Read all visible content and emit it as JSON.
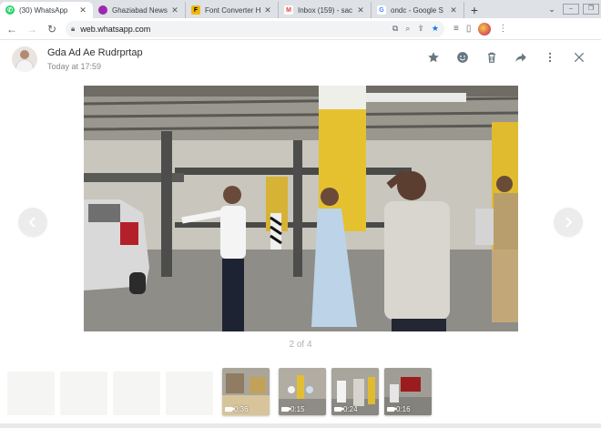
{
  "tabs": [
    {
      "title": "(30) WhatsApp",
      "icon": "whatsapp-icon",
      "color": "#25d366"
    },
    {
      "title": "Ghaziabad News",
      "icon": "news-icon",
      "color": "#9c27b0"
    },
    {
      "title": "Font Converter H",
      "icon": "font-converter-icon",
      "color": "#f2b705"
    },
    {
      "title": "Inbox (159) - sac",
      "icon": "gmail-icon",
      "color": "#ea4335"
    },
    {
      "title": "ondc - Google S",
      "icon": "google-icon",
      "color": "#4285f4"
    }
  ],
  "address": {
    "url": "web.whatsapp.com"
  },
  "viewer": {
    "sender": "Gda Ad Ae Rudrprtap",
    "timestamp": "Today at 17:59",
    "counter": "2 of 4"
  },
  "thumbnails": [
    {
      "duration": "0:36"
    },
    {
      "duration": "0:15"
    },
    {
      "duration": "0:24"
    },
    {
      "duration": "0:16"
    }
  ],
  "colors": {
    "accent": "#25d366",
    "icon_grey": "#667781"
  }
}
